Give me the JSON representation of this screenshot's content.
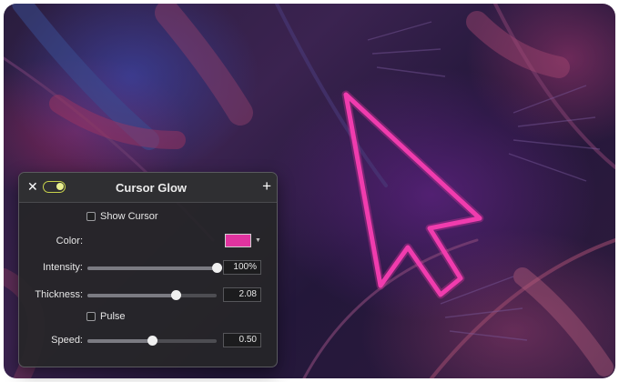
{
  "panel": {
    "title": "Cursor Glow",
    "close_icon": "close-icon",
    "add_icon": "plus-icon",
    "enabled": true,
    "show_cursor": {
      "label": "Show Cursor",
      "checked": false
    },
    "color": {
      "label": "Color:",
      "value": "#e0339f"
    },
    "intensity": {
      "label": "Intensity:",
      "value": "100%",
      "level": 1.0
    },
    "thickness": {
      "label": "Thickness:",
      "value": "2.08",
      "level": 0.68
    },
    "pulse": {
      "label": "Pulse",
      "checked": false
    },
    "speed": {
      "label": "Speed:",
      "value": "0.50",
      "level": 0.5
    }
  },
  "colors": {
    "glow": "#e0339f",
    "toggle_accent": "#c9d34b"
  }
}
